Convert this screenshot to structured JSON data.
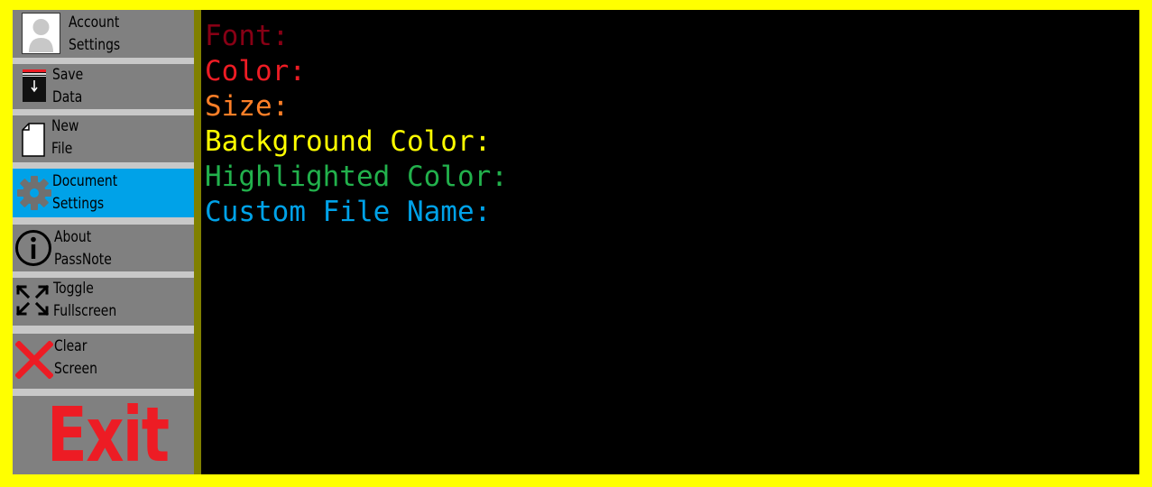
{
  "sidebar": {
    "items": [
      {
        "line1": "Account",
        "line2": "Settings",
        "icon": "user-avatar-icon"
      },
      {
        "line1": "Save",
        "line2": "Data",
        "icon": "save-data-icon"
      },
      {
        "line1": "New",
        "line2": "File",
        "icon": "new-file-icon"
      },
      {
        "line1": "Document",
        "line2": "Settings",
        "icon": "gear-icon",
        "active": true
      },
      {
        "line1": "About",
        "line2": "PassNote",
        "icon": "info-icon"
      },
      {
        "line1": "Toggle",
        "line2": "Fullscreen",
        "icon": "fullscreen-toggle-icon"
      },
      {
        "line1": "Clear",
        "line2": "Screen",
        "icon": "red-x-icon"
      }
    ],
    "exit_label": "Exit"
  },
  "document_settings": {
    "font_label": "Font:",
    "color_label": "Color:",
    "size_label": "Size:",
    "background_color_label": "Background Color:",
    "highlighted_color_label": "Highlighted Color:",
    "custom_file_name_label": "Custom File Name:"
  },
  "colors": {
    "frame_border": "#ffff00",
    "sidebar_item": "#808080",
    "sidebar_active": "#00a2e8",
    "main_background": "#000000",
    "font_label": "#880015",
    "color_label": "#ed1c24",
    "size_label": "#ff7f27",
    "background_color_label": "#ffff00",
    "highlighted_color_label": "#22b14c",
    "custom_file_name_label": "#00a2e8",
    "exit": "#ed1c24"
  }
}
